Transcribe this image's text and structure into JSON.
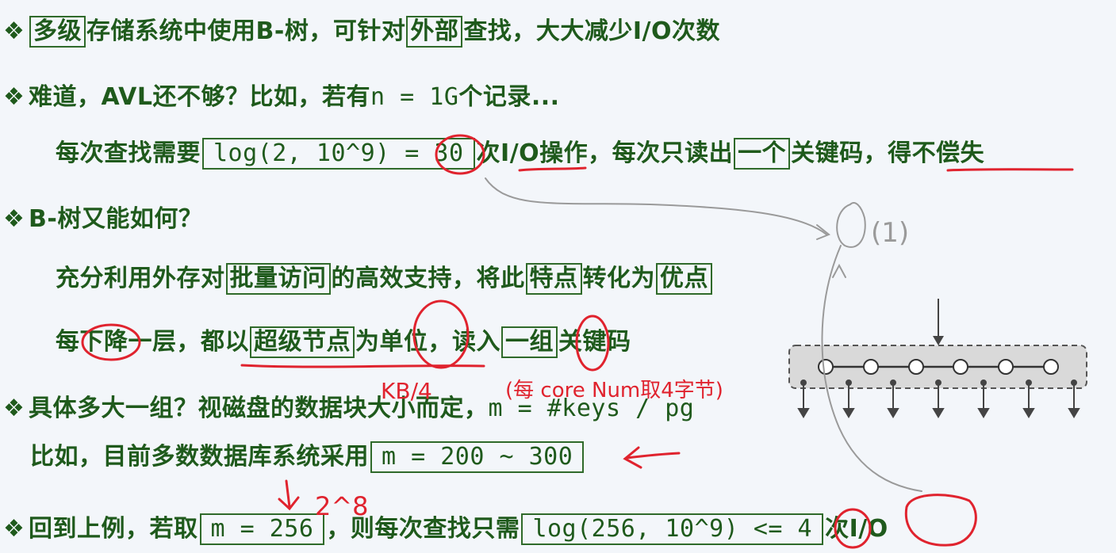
{
  "lines": {
    "l1": {
      "bullet": "❖",
      "box1": "多级",
      "t1": "存储系统中使用B-树，可针对",
      "box2": "外部",
      "t2": "查找，大大减少I/O次数"
    },
    "l2": {
      "bullet": "❖",
      "t1": "难道，AVL还不够？比如，若有",
      "t2": "n = 1G",
      "t3": "个记录..."
    },
    "l3": {
      "t1": "每次查找需要",
      "code": "log(2, 10^9) = 30",
      "t2": "次",
      "t3": "I/O",
      "t4": "操作，每次只读出",
      "box1": "一个",
      "t5": "关键码，",
      "t6": "得不偿失"
    },
    "l4": {
      "bullet": "❖",
      "t1": "B-树又能如何？"
    },
    "l5": {
      "t1": "充分利用外存对",
      "box1": "批量访问",
      "t2": "的高效支持，将此",
      "box2": "特点",
      "t3": "转化为",
      "box3": "优点"
    },
    "l6": {
      "t1": "每下降一层，都以",
      "box1": "超级节点",
      "t2": "为单位，读入",
      "box2": "一组",
      "t3": "关键码"
    },
    "l7": {
      "bullet": "❖",
      "t1": "具体多大一组？视磁盘的数据块大小而定，",
      "t2": "m = #keys / pg"
    },
    "l8": {
      "t1": "比如，目前多数数据库系统采用",
      "code": "m = 200 ~ 300"
    },
    "l9": {
      "bullet": "❖",
      "t1": "回到上例，若取",
      "code1": "m = 256",
      "t2": "，则每次查找只需",
      "code2": "log(256, 10^9) <= 4",
      "t3": "次I/O"
    }
  },
  "annotations": {
    "circle_label": "(1)",
    "kb": "KB/4",
    "core_note": "(每 core Num取4字节)",
    "pow": "2^8"
  },
  "colors": {
    "text": "#1f5a1c",
    "box_border": "#2f6a2a",
    "ink_red": "#e0232e",
    "diagram_fill": "#d9d9d9",
    "background": "#f3f6fa"
  }
}
